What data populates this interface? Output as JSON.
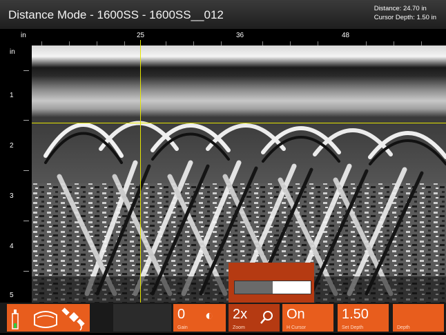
{
  "window": {
    "title": "Distance Mode - 1600SS - 1600SS__012",
    "distance": "Distance: 24.70 in",
    "cursor_depth": "Cursor Depth: 1.50 in"
  },
  "ruler_top": {
    "unit": "in",
    "ticks": [
      "25",
      "36",
      "48"
    ]
  },
  "ruler_left": {
    "unit": "in",
    "ticks": [
      "1",
      "2",
      "3",
      "4",
      "5"
    ]
  },
  "popup": {
    "gain_slider_fraction": 0.5
  },
  "toolbar": {
    "battery_icon": "battery-icon",
    "scan_icon": "scan-device-icon",
    "gps_icon": "satellite-icon",
    "gain": {
      "value": "0",
      "label": "Gain"
    },
    "contrast_icon": "contrast-icon",
    "zoom": {
      "value": "2x",
      "label": "Zoom"
    },
    "zoom_icon": "magnifier-icon",
    "cursor": {
      "value": "On",
      "label": "H Cursor"
    },
    "depth": {
      "value": "1.50",
      "label": "Set Depth"
    },
    "extra": {
      "value": "",
      "label": "Depth"
    }
  },
  "colors": {
    "accent": "#e85d1d",
    "cursor": "#e6e600",
    "popup": "#b53a12"
  }
}
